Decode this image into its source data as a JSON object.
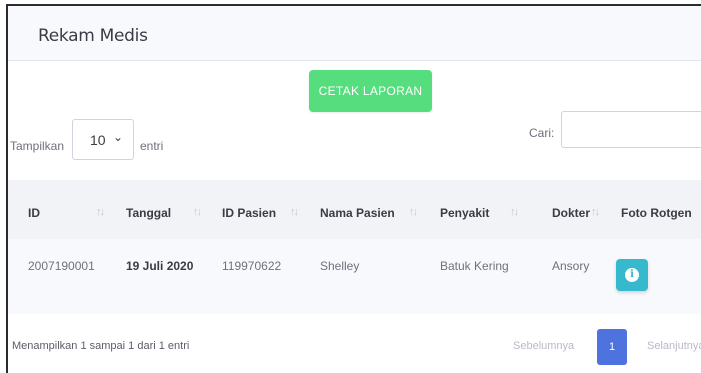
{
  "card": {
    "title": "Rekam Medis"
  },
  "actions": {
    "print_label": "CETAK LAPORAN"
  },
  "length": {
    "show_label": "Tampilkan",
    "value": "10",
    "entries_label": "entri"
  },
  "search": {
    "label": "Cari:",
    "value": ""
  },
  "table": {
    "headers": [
      "ID",
      "Tanggal",
      "ID Pasien",
      "Nama Pasien",
      "Penyakit",
      "Dokter",
      "Foto Rotgen"
    ],
    "rows": [
      [
        "2007190001",
        "19 Juli 2020",
        "119970622",
        "Shelley",
        "Batuk Kering",
        "Ansory",
        "info-icon"
      ]
    ]
  },
  "footer": {
    "info": "Menampilkan 1 sampai 1 dari 1 entri",
    "prev": "Sebelumnya",
    "current_page": "1",
    "next": "Selanjutnya"
  },
  "colors": {
    "print_button": "#56dd7e",
    "info_button": "#36b9cc",
    "page_active": "#4e73df"
  }
}
